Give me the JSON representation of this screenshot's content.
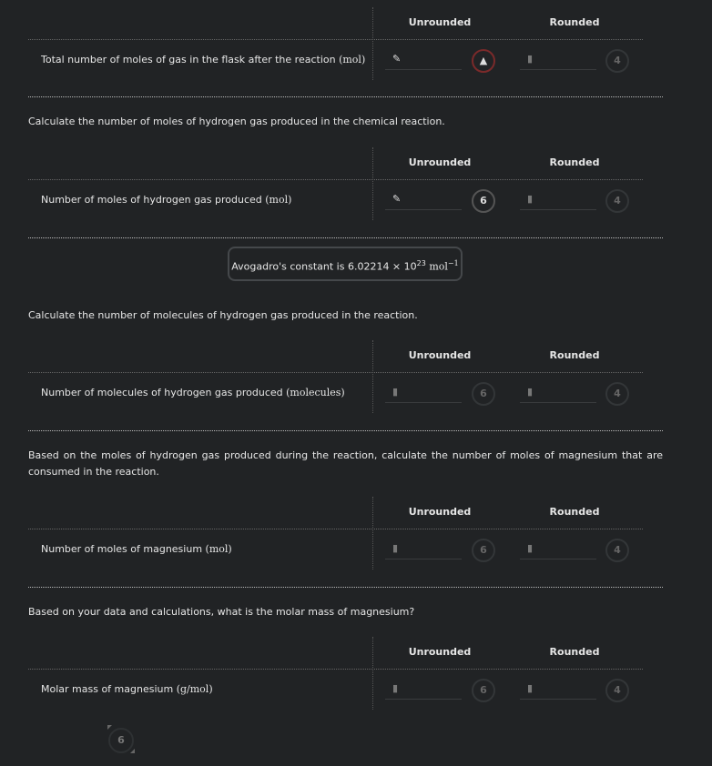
{
  "columns": {
    "unrounded": "Unrounded",
    "rounded": "Rounded"
  },
  "sections": [
    {
      "question": "",
      "label": "Total number of moles of gas in the flask after the reaction ",
      "unit": "(mol)",
      "unrounded_icon": "pencil-icon",
      "unrounded_badge": "!",
      "unrounded_state": "warning",
      "rounded_badge": "4"
    },
    {
      "question": "Calculate the number of moles of hydrogen gas produced in the chemical reaction.",
      "label": "Number of moles of hydrogen gas produced ",
      "unit": "(mol)",
      "unrounded_icon": "pencil-icon",
      "unrounded_badge": "6",
      "unrounded_state": "active",
      "rounded_badge": "4"
    },
    {
      "question": "Calculate the number of molecules of hydrogen gas produced in the reaction.",
      "label": "Number of molecules of hydrogen gas produced ",
      "unit": "(molecules)",
      "unrounded_icon": "lock-icon",
      "unrounded_badge": "6",
      "unrounded_state": "locked",
      "rounded_badge": "4"
    },
    {
      "question": "Based on the moles of hydrogen gas produced during the reaction, calculate the number of moles of magnesium that are consumed in the reaction.",
      "label": "Number of moles of magnesium ",
      "unit": "(mol)",
      "unrounded_icon": "lock-icon",
      "unrounded_badge": "6",
      "unrounded_state": "locked",
      "rounded_badge": "4"
    },
    {
      "question": "Based on your data and calculations, what is the molar mass of magnesium?",
      "label": "Molar mass of magnesium ",
      "unit": "(g/mol)",
      "unrounded_icon": "lock-icon",
      "unrounded_badge": "6",
      "unrounded_state": "locked",
      "rounded_badge": "4"
    }
  ],
  "note": {
    "text": "Avogadro's constant is 6.02214 × 10",
    "exp": "23",
    "unit": " mol",
    "unit_exp": "−1"
  },
  "footer_badge": "6"
}
